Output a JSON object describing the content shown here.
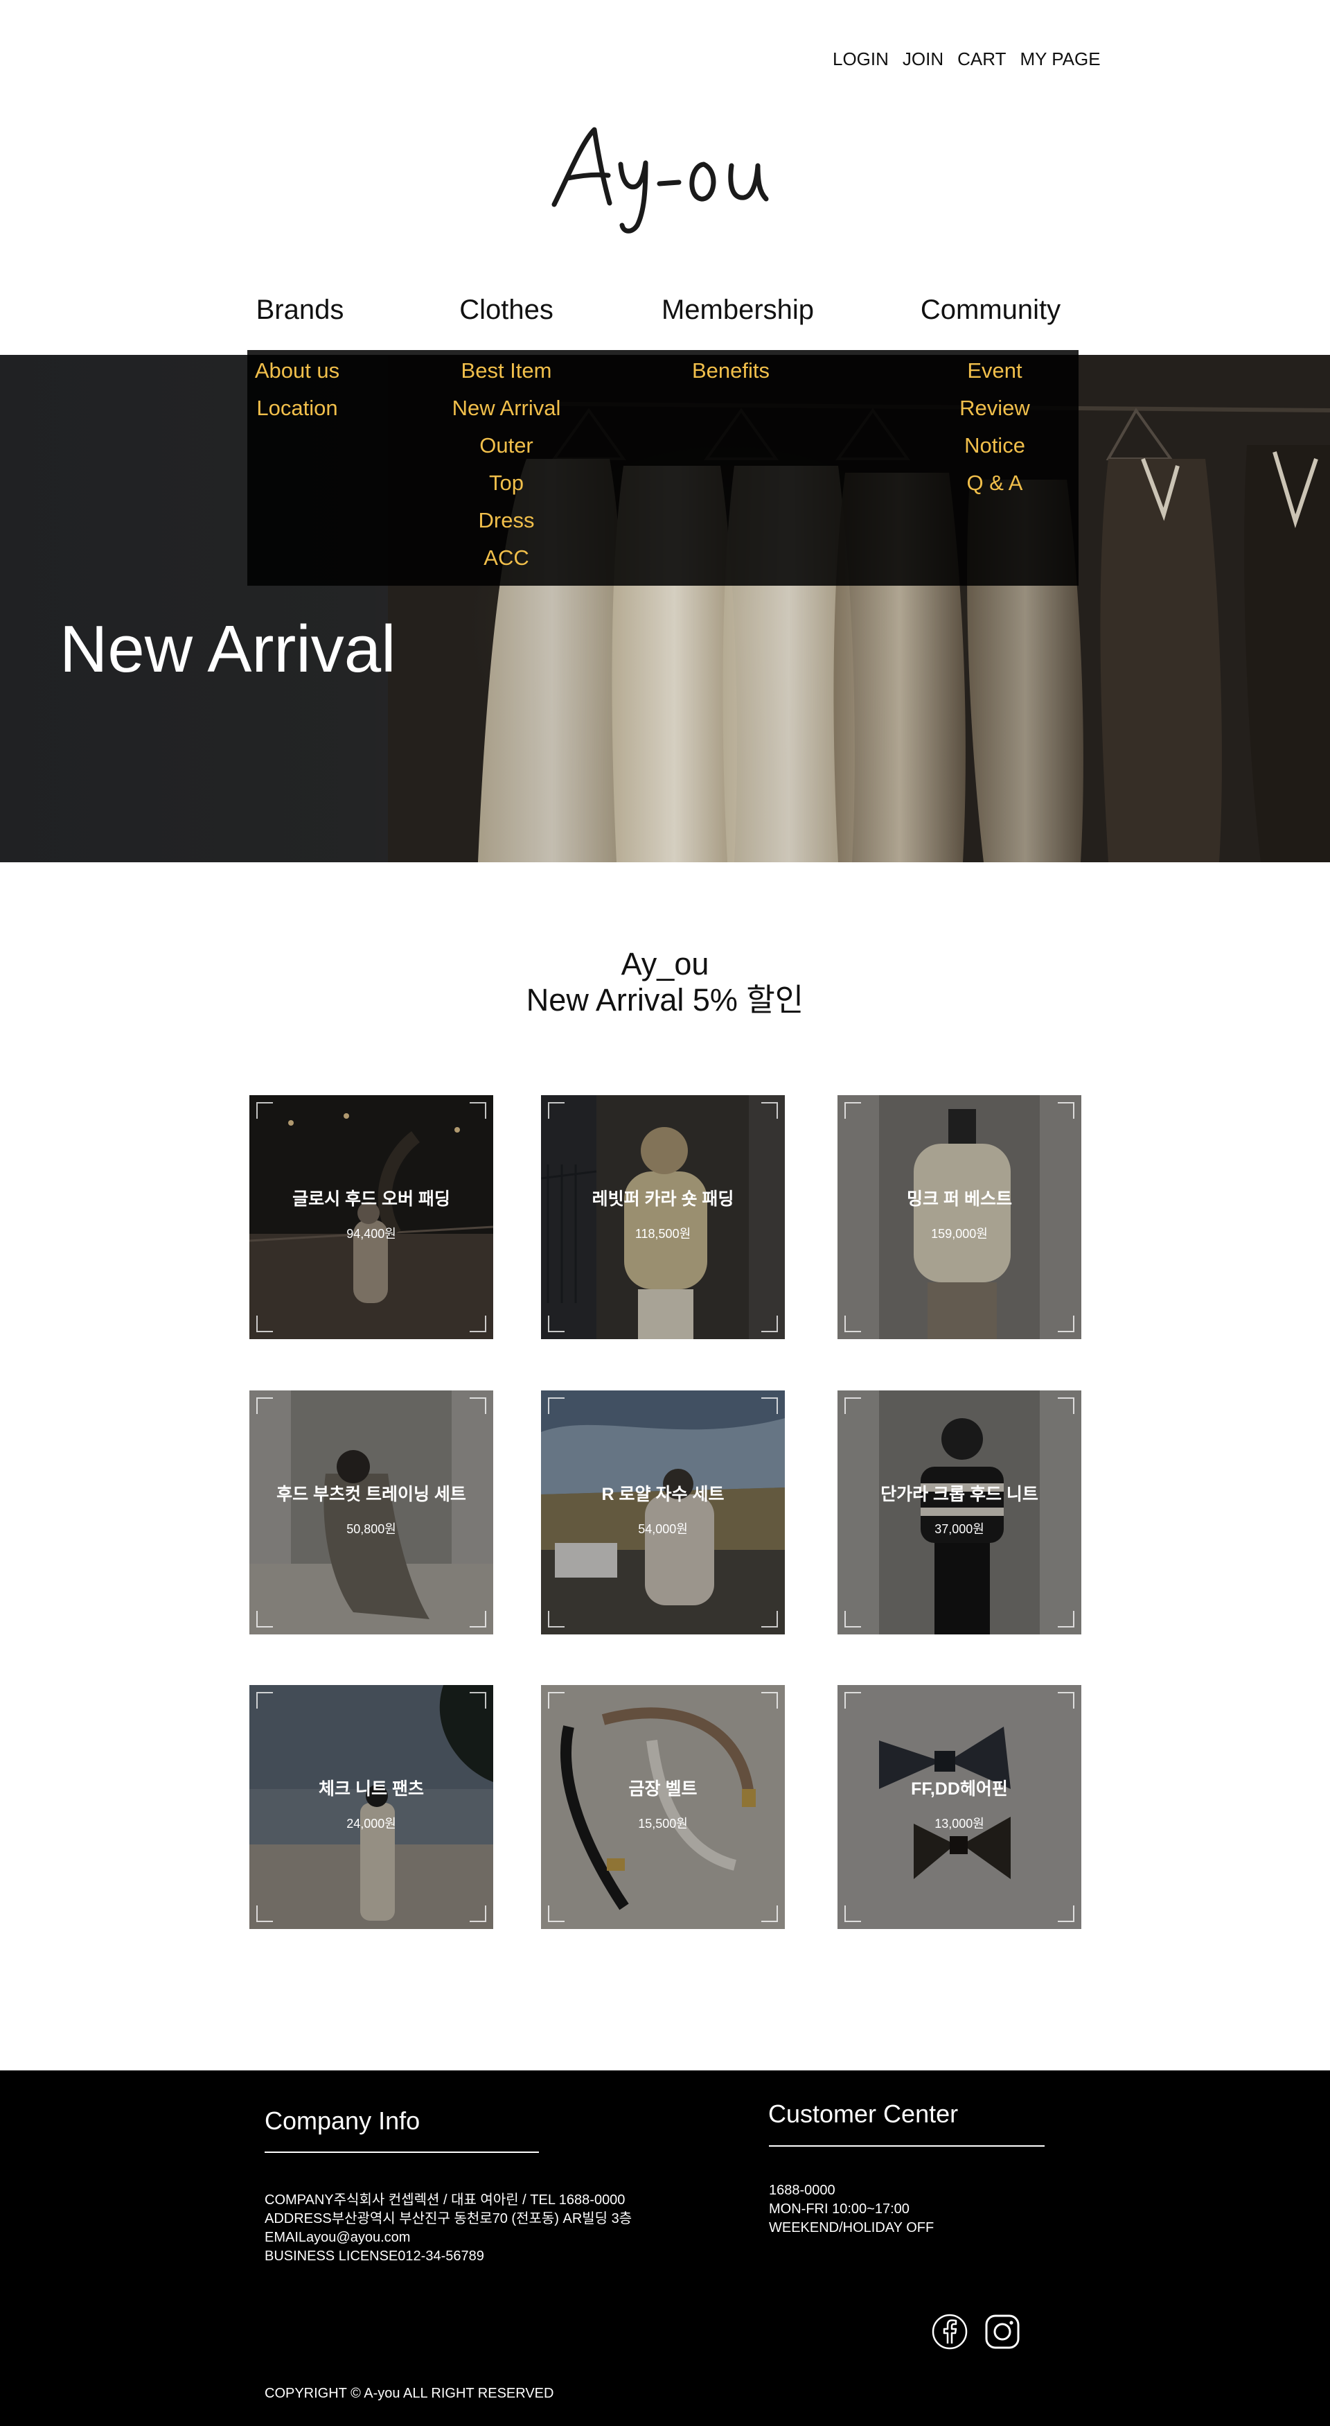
{
  "header": {
    "links": [
      "LOGIN",
      "JOIN",
      "CART",
      "MY PAGE"
    ],
    "logo": "Ay-ou"
  },
  "nav": {
    "items": [
      {
        "label": "Brands",
        "submenu": [
          "About us",
          "Location"
        ]
      },
      {
        "label": "Clothes",
        "submenu": [
          "Best Item",
          "New Arrival",
          "Outer",
          "Top",
          "Dress",
          "ACC"
        ]
      },
      {
        "label": "Membership",
        "submenu": [
          "Benefits"
        ]
      },
      {
        "label": "Community",
        "submenu": [
          "Event",
          "Review",
          "Notice",
          "Q & A"
        ]
      }
    ],
    "submenu_color": "#f1bf4b"
  },
  "hero": {
    "title": "New Arrival"
  },
  "promo": {
    "line1": "Ay_ou",
    "line2": "New Arrival 5% 할인"
  },
  "products": [
    {
      "name": "글로시 후드 오버 패딩",
      "price": "94,400원"
    },
    {
      "name": "레빗퍼 카라 숏 패딩",
      "price": "118,500원"
    },
    {
      "name": "밍크 퍼 베스트",
      "price": "159,000원"
    },
    {
      "name": "후드 부츠컷 트레이닝 세트",
      "price": "50,800원"
    },
    {
      "name": "R 로얄 자수 세트",
      "price": "54,000원"
    },
    {
      "name": "단가라 크롭 후드 니트",
      "price": "37,000원"
    },
    {
      "name": "체크 니트 팬츠",
      "price": "24,000원"
    },
    {
      "name": "금장 벨트",
      "price": "15,500원"
    },
    {
      "name": "FF,DD헤어핀",
      "price": "13,000원"
    }
  ],
  "footer": {
    "company_title": "Company Info",
    "company_rows": [
      {
        "key": "COMPANY",
        "value": "주식회사 컨셉렉션 / 대표 여아린 / TEL 1688-0000"
      },
      {
        "key": "ADDRESS",
        "value": "부산광역시 부산진구 동천로70 (전포동) AR빌딩 3층"
      },
      {
        "key": "EMAIL",
        "value": "ayou@ayou.com"
      },
      {
        "key": "BUSINESS LICENSE",
        "value": "012-34-56789"
      }
    ],
    "customer_title": "Customer Center",
    "customer_rows": [
      "1688-0000",
      "MON-FRI 10:00~17:00",
      "WEEKEND/HOLIDAY OFF"
    ],
    "social_icons": [
      "facebook-icon",
      "instagram-icon"
    ],
    "copyright": "COPYRIGHT © A-you ALL RIGHT RESERVED"
  }
}
